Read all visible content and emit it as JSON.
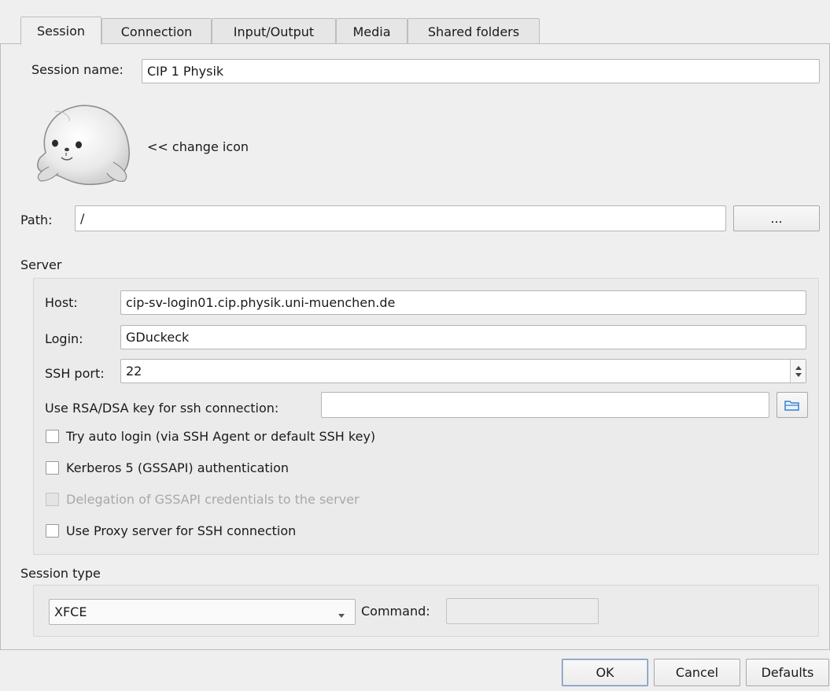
{
  "tabs": [
    {
      "label": "Session",
      "mnemonic": "S"
    },
    {
      "label": "Connection",
      "mnemonic": "C"
    },
    {
      "label": "Input/Output",
      "mnemonic": "I"
    },
    {
      "label": "Media",
      "mnemonic": "M"
    },
    {
      "label": "Shared folders",
      "mnemonic": "S"
    }
  ],
  "session": {
    "name_label": "Session name:",
    "name_value": "CIP 1 Physik",
    "change_icon_label": "<< change icon",
    "path_label": "Path:",
    "path_value": "/",
    "browse_label": "..."
  },
  "server": {
    "title": "Server",
    "host_label": "Host:",
    "host_value": "cip-sv-login01.cip.physik.uni-muenchen.de",
    "login_label": "Login:",
    "login_value": "GDuckeck",
    "ssh_port_label": "SSH port:",
    "ssh_port_value": "22",
    "rsa_label": "Use RSA/DSA key for ssh connection:",
    "rsa_value": "",
    "checkboxes": [
      {
        "label": "Try auto login (via SSH Agent or default SSH key)",
        "checked": false,
        "enabled": true
      },
      {
        "label": "Kerberos 5 (GSSAPI) authentication",
        "checked": false,
        "enabled": true
      },
      {
        "label": "Delegation of GSSAPI credentials to the server",
        "checked": false,
        "enabled": false
      },
      {
        "label": "Use Proxy server for SSH connection",
        "checked": false,
        "enabled": true
      }
    ]
  },
  "session_type": {
    "title": "Session type",
    "selected": "XFCE",
    "command_label": "Command:",
    "command_value": ""
  },
  "buttons": {
    "ok": "OK",
    "cancel": "Cancel",
    "defaults": "Defaults"
  },
  "colors": {
    "background": "#efefef",
    "accent_border": "#6d8cb7",
    "folder_icon": "#3a7fd0"
  }
}
